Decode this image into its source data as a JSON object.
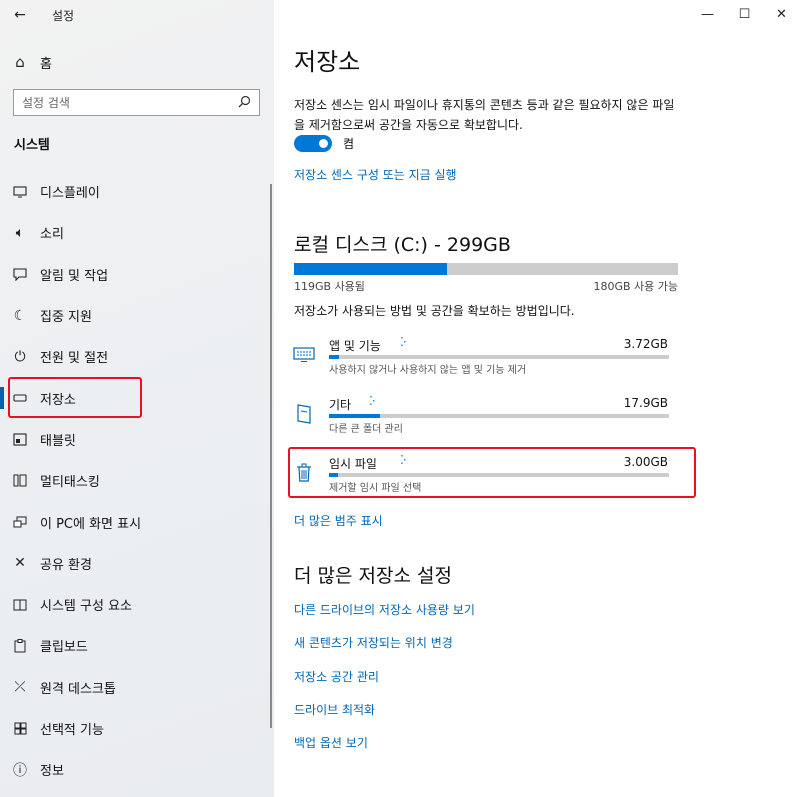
{
  "window": {
    "title": "설정",
    "minimize": "—",
    "maximize": "☐",
    "close": "✕"
  },
  "sidebar": {
    "home_label": "홈",
    "search_placeholder": "설정 검색",
    "section_title": "시스템",
    "items": [
      {
        "label": "디스플레이",
        "icon": "display-icon"
      },
      {
        "label": "소리",
        "icon": "sound-icon"
      },
      {
        "label": "알림 및 작업",
        "icon": "notification-icon"
      },
      {
        "label": "집중 지원",
        "icon": "moon-icon"
      },
      {
        "label": "전원 및 절전",
        "icon": "power-icon"
      },
      {
        "label": "저장소",
        "icon": "storage-icon",
        "active": true
      },
      {
        "label": "태블릿",
        "icon": "tablet-icon"
      },
      {
        "label": "멀티태스킹",
        "icon": "multitasking-icon"
      },
      {
        "label": "이 PC에 화면 표시",
        "icon": "project-icon"
      },
      {
        "label": "공유 환경",
        "icon": "shared-icon"
      },
      {
        "label": "시스템 구성 요소",
        "icon": "components-icon"
      },
      {
        "label": "클립보드",
        "icon": "clipboard-icon"
      },
      {
        "label": "원격 데스크톱",
        "icon": "remote-desktop-icon"
      },
      {
        "label": "선택적 기능",
        "icon": "optional-features-icon"
      },
      {
        "label": "정보",
        "icon": "info-icon"
      }
    ]
  },
  "main": {
    "title": "저장소",
    "description": "저장소 센스는 임시 파일이나 휴지통의 콘텐츠 등과 같은 필요하지 않은 파일을 제거함으로써 공간을 자동으로 확보합니다.",
    "toggle_state": "켬",
    "storage_sense_link": "저장소 센스 구성 또는 지금 실행",
    "drive": {
      "title": "로컬 디스크 (C:) - 299GB",
      "used_label": "119GB 사용됨",
      "free_label": "180GB 사용 가능",
      "used_fraction": 0.398
    },
    "info_text": "저장소가 사용되는 방법 및 공간을 확보하는 방법입니다.",
    "categories": [
      {
        "name": "앱 및 기능",
        "size": "3.72GB",
        "sub": "사용하지 않거나 사용하지 않는 앱 및 기능 제거",
        "fraction": 0.03,
        "icon": "apps-icon"
      },
      {
        "name": "기타",
        "size": "17.9GB",
        "sub": "다른 큰 폴더 관리",
        "fraction": 0.15,
        "icon": "other-icon"
      },
      {
        "name": "임시 파일",
        "size": "3.00GB",
        "sub": "제거할 임시 파일 선택",
        "fraction": 0.025,
        "icon": "trash-icon"
      }
    ],
    "show_more_link": "더 많은 범주 표시",
    "more_settings_title": "더 많은 저장소 설정",
    "more_links": [
      "다른 드라이브의 저장소 사용량 보기",
      "새 콘텐츠가 저장되는 위치 변경",
      "저장소 공간 관리",
      "드라이브 최적화",
      "백업 옵션 보기"
    ]
  }
}
